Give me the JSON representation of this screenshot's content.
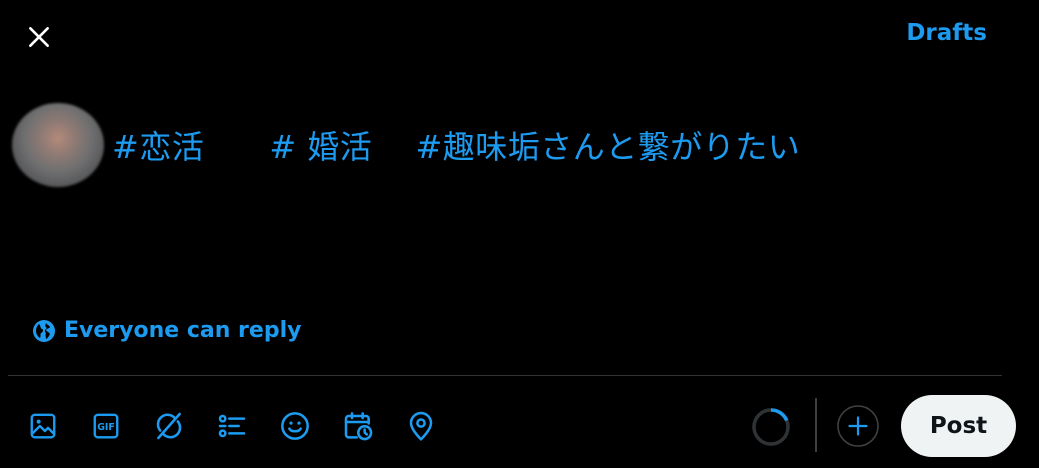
{
  "header": {
    "close_icon": "close-icon",
    "drafts_label": "Drafts"
  },
  "composer": {
    "avatar_icon": "avatar",
    "text": "#恋活　　# 婚活　 #趣味垢さんと繋がりたい"
  },
  "reply_setting": {
    "icon": "globe-icon",
    "label": "Everyone can reply"
  },
  "toolbar": {
    "tools": [
      "image-icon",
      "gif-icon",
      "grok-icon",
      "poll-icon",
      "emoji-icon",
      "schedule-icon",
      "location-icon"
    ],
    "add_icon": "plus-circle-icon",
    "post_label": "Post"
  },
  "colors": {
    "accent": "#1d9bf0",
    "background": "#000000",
    "divider": "#2f3336",
    "post_button_bg": "#eff3f4",
    "post_button_text": "#0f1419"
  }
}
